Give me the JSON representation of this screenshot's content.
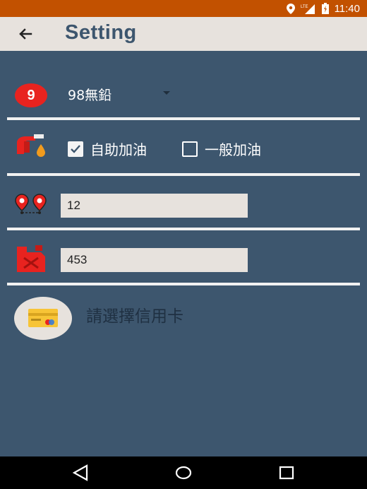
{
  "status_bar": {
    "network_label": "LTE",
    "time": "11:40"
  },
  "app_bar": {
    "back_icon": "arrow-back-icon",
    "title": "Setting"
  },
  "fuel": {
    "grade_badge": "9",
    "selected_value": "98無鉛"
  },
  "service": {
    "icon": "gas-pump-icon",
    "options": [
      {
        "label": "自助加油",
        "checked": true
      },
      {
        "label": "一般加油",
        "checked": false
      }
    ]
  },
  "distance": {
    "icon": "route-pins-icon",
    "value": "12"
  },
  "fuel_amount": {
    "icon": "jerrycan-icon",
    "value": "453"
  },
  "credit_card": {
    "icon": "credit-card-icon",
    "label": "請選擇信用卡"
  },
  "nav": {
    "back": "nav-back-icon",
    "home": "nav-home-icon",
    "recents": "nav-recents-icon"
  },
  "colors": {
    "background": "#3d566e",
    "status_bar": "#c25100",
    "app_bar": "#e7e2dd",
    "accent_red": "#e8231f",
    "title": "#3d566e"
  }
}
